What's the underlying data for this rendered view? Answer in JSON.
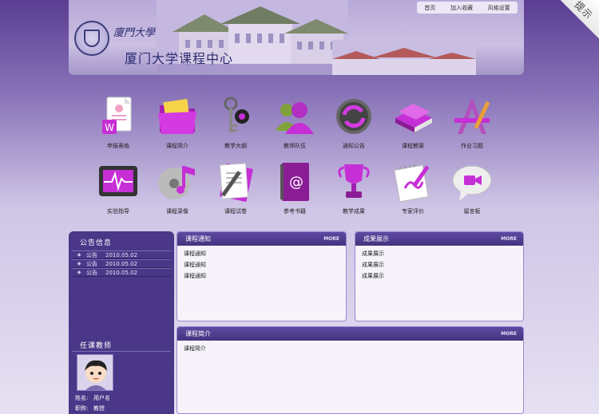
{
  "corner": {
    "label": "提示"
  },
  "header": {
    "calligraphy": "廈門大學",
    "site_title": "厦门大学课程中心",
    "nav": [
      "首页",
      "加入收藏",
      "风格设置"
    ]
  },
  "icons": [
    {
      "label": "申报表格",
      "icon": "word-document-icon"
    },
    {
      "label": "课程简介",
      "icon": "folder-icon"
    },
    {
      "label": "教学大纲",
      "icon": "keys-icon"
    },
    {
      "label": "教师队伍",
      "icon": "users-icon"
    },
    {
      "label": "通知公告",
      "icon": "refresh-icon"
    },
    {
      "label": "课程教案",
      "icon": "books-icon"
    },
    {
      "label": "作业习题",
      "icon": "drafting-tools-icon"
    },
    {
      "label": "实验指导",
      "icon": "monitor-icon"
    },
    {
      "label": "课程录像",
      "icon": "music-disc-icon"
    },
    {
      "label": "课程试卷",
      "icon": "pen-paper-icon"
    },
    {
      "label": "参考书籍",
      "icon": "address-book-icon"
    },
    {
      "label": "教学成果",
      "icon": "trophy-icon"
    },
    {
      "label": "专家评价",
      "icon": "notepad-icon"
    },
    {
      "label": "留言板",
      "icon": "video-chat-icon"
    }
  ],
  "announcements": {
    "title": "公告信息",
    "items": [
      {
        "tag": "公告",
        "date": "2010.05.02"
      },
      {
        "tag": "公告",
        "date": "2010.05.02"
      },
      {
        "tag": "公告",
        "date": "2010.05.02"
      }
    ]
  },
  "teacher": {
    "title": "任课教师",
    "name_label": "姓名:",
    "name": "用户名",
    "rank_label": "职称:",
    "rank": "教授"
  },
  "course_notice": {
    "title": "课程通知",
    "more": "MORE",
    "items": [
      "课程通知",
      "课程通知",
      "课程通知"
    ]
  },
  "achievements": {
    "title": "成果展示",
    "more": "MORE",
    "items": [
      "成果展示",
      "成果展示",
      "成果展示"
    ]
  },
  "course_intro": {
    "title": "课程简介",
    "more": "MORE",
    "body": "课程简介"
  },
  "colors": {
    "accent": "#4a3788",
    "icon_magenta": "#c62fd6"
  }
}
